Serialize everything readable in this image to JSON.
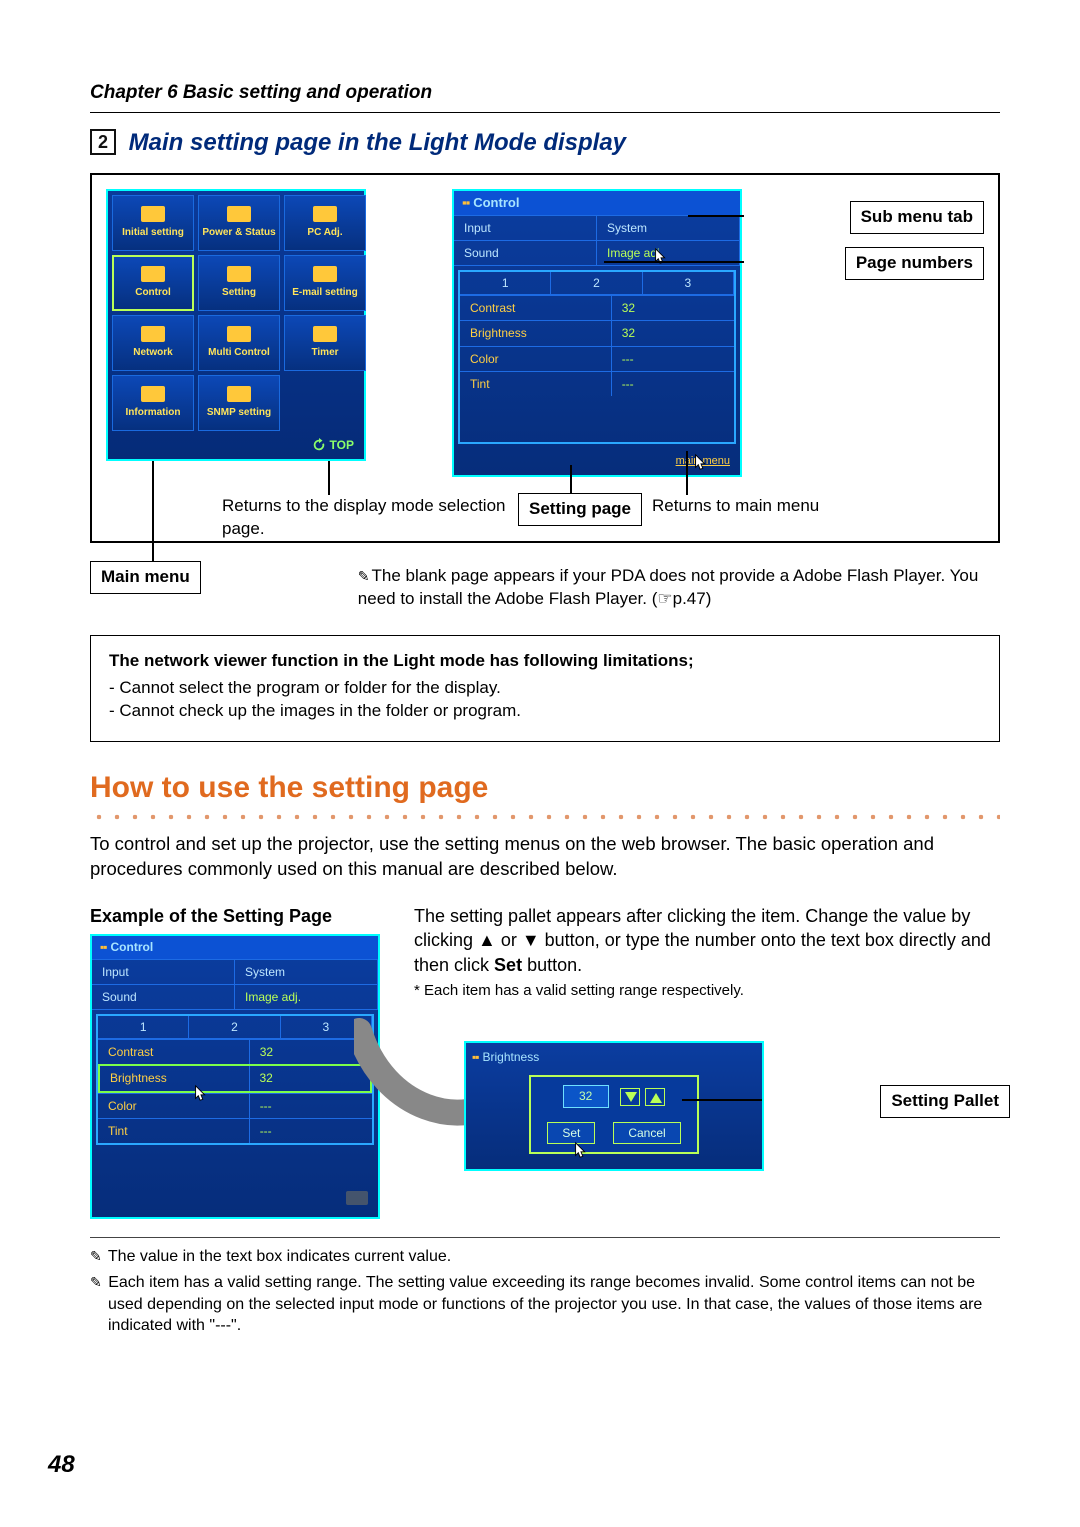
{
  "chapter": "Chapter 6 Basic setting and operation",
  "section_number": "2",
  "section_title": "Main setting page in the Light Mode display",
  "mainmenu": {
    "items": [
      "Initial setting",
      "Power & Status",
      "PC Adj.",
      "Control",
      "Setting",
      "E-mail setting",
      "Network",
      "Multi Control",
      "Timer",
      "Information",
      "SNMP setting"
    ],
    "top_label": "TOP"
  },
  "control_panel": {
    "title": "Control",
    "sub_tabs": [
      "Input",
      "System",
      "Sound",
      "Image adj."
    ],
    "selected_sub": 3,
    "pages": [
      "1",
      "2",
      "3"
    ],
    "rows": [
      {
        "label": "Contrast",
        "value": "32"
      },
      {
        "label": "Brightness",
        "value": "32"
      },
      {
        "label": "Color",
        "value": "---"
      },
      {
        "label": "Tint",
        "value": "---"
      }
    ],
    "main_link": "main menu"
  },
  "callouts": {
    "sub_menu_tab": "Sub menu tab",
    "page_numbers": "Page numbers",
    "setting_page": "Setting page",
    "main_menu": "Main menu",
    "returns_display_mode": "Returns to the display mode selection page.",
    "returns_main_menu": "Returns to main menu",
    "setting_pallet": "Setting Pallet"
  },
  "note_pda": "The blank page appears if your PDA does not provide a Adobe Flash Player. You need to install the Adobe Flash Player. (☞p.47)",
  "limits": {
    "title": "The network viewer function in the Light mode has following limitations;",
    "items": [
      "- Cannot select the program or folder for the display.",
      "- Cannot check up the images in the folder or program."
    ]
  },
  "howto_heading": "How to use the setting page",
  "howto_para": "To control and set up the projector, use the setting menus on the web browser. The basic operation and procedures commonly used on this manual are described below.",
  "example_title": "Example of the Setting Page",
  "example_para_1": "The setting pallet appears after clicking the item. Change the value by clicking ▲ or ▼ button, or type the number onto the text box directly and then click ",
  "example_para_set": "Set",
  "example_para_2": " button.",
  "example_note": "* Each item has a valid setting range respectively.",
  "pallet": {
    "title": "Brightness",
    "value": "32",
    "set": "Set",
    "cancel": "Cancel"
  },
  "footnote_1": "The value in the text box indicates current value.",
  "footnote_2": "Each item has a valid setting range. The setting value exceeding its range becomes invalid. Some control items can not be used depending on the selected input mode or functions of the projector you use. In that case, the values of those items are indicated with \"---\".",
  "page_number": "48"
}
